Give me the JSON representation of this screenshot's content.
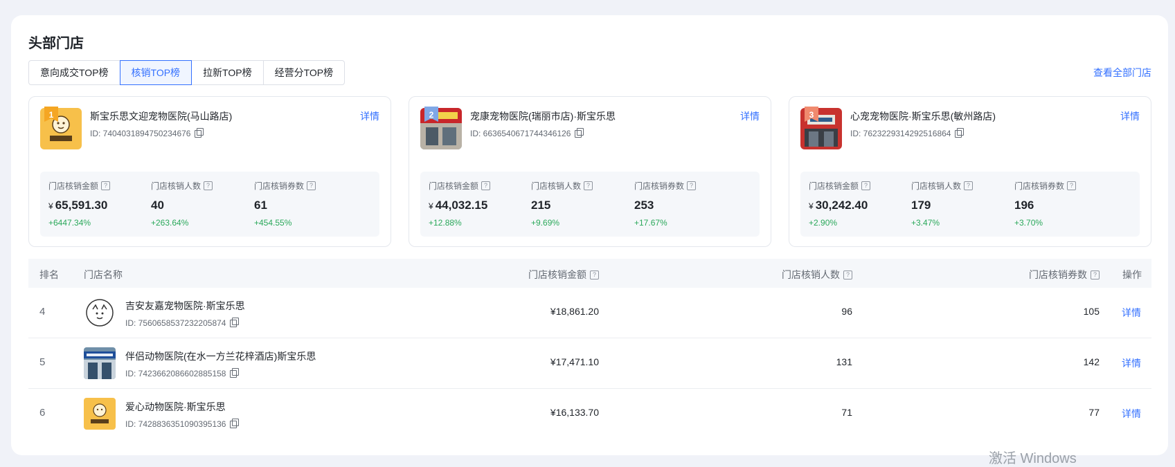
{
  "page": {
    "title": "头部门店",
    "view_all": "查看全部门店",
    "tabs": [
      {
        "label": "意向成交TOP榜",
        "active": false
      },
      {
        "label": "核销TOP榜",
        "active": true
      },
      {
        "label": "拉新TOP榜",
        "active": false
      },
      {
        "label": "经营分TOP榜",
        "active": false
      }
    ]
  },
  "top_cards": [
    {
      "rank": "1",
      "badge_color": "#f5a623",
      "name": "斯宝乐思文迎宠物医院(马山路店)",
      "id": "ID: 7404031894750234676",
      "detail": "详情",
      "metrics": [
        {
          "label": "门店核销金额",
          "currency": "¥",
          "value": "65,591.30",
          "delta": "+6447.34%"
        },
        {
          "label": "门店核销人数",
          "currency": "",
          "value": "40",
          "delta": "+263.64%"
        },
        {
          "label": "门店核销券数",
          "currency": "",
          "value": "61",
          "delta": "+454.55%"
        }
      ]
    },
    {
      "rank": "2",
      "badge_color": "#7fa7e6",
      "name": "宠康宠物医院(瑞丽市店)·斯宝乐思",
      "id": "ID: 6636540671744346126",
      "detail": "详情",
      "metrics": [
        {
          "label": "门店核销金额",
          "currency": "¥",
          "value": "44,032.15",
          "delta": "+12.88%"
        },
        {
          "label": "门店核销人数",
          "currency": "",
          "value": "215",
          "delta": "+9.69%"
        },
        {
          "label": "门店核销券数",
          "currency": "",
          "value": "253",
          "delta": "+17.67%"
        }
      ]
    },
    {
      "rank": "3",
      "badge_color": "#f08a6e",
      "name": "心宠宠物医院·斯宝乐思(敏州路店)",
      "id": "ID: 7623229314292516864",
      "detail": "详情",
      "metrics": [
        {
          "label": "门店核销金额",
          "currency": "¥",
          "value": "30,242.40",
          "delta": "+2.90%"
        },
        {
          "label": "门店核销人数",
          "currency": "",
          "value": "179",
          "delta": "+3.47%"
        },
        {
          "label": "门店核销券数",
          "currency": "",
          "value": "196",
          "delta": "+3.70%"
        }
      ]
    }
  ],
  "table": {
    "headers": {
      "rank": "排名",
      "name": "门店名称",
      "amount": "门店核销金额",
      "people": "门店核销人数",
      "coupons": "门店核销券数",
      "action": "操作"
    },
    "rows": [
      {
        "rank": "4",
        "name": "吉安友嘉宠物医院·斯宝乐思",
        "id": "ID: 7560658537232205874",
        "amount": "¥18,861.20",
        "people": "96",
        "coupons": "105",
        "detail": "详情"
      },
      {
        "rank": "5",
        "name": "伴侣动物医院(在水一方兰花梓酒店)斯宝乐思",
        "id": "ID: 7423662086602885158",
        "amount": "¥17,471.10",
        "people": "131",
        "coupons": "142",
        "detail": "详情"
      },
      {
        "rank": "6",
        "name": "爱心动物医院·斯宝乐思",
        "id": "ID: 7428836351090395136",
        "amount": "¥16,133.70",
        "people": "71",
        "coupons": "77",
        "detail": "详情"
      }
    ]
  },
  "os_watermark": "激活 Windows",
  "colors": {
    "accent": "#3370ff",
    "positive": "#2aa85a"
  }
}
